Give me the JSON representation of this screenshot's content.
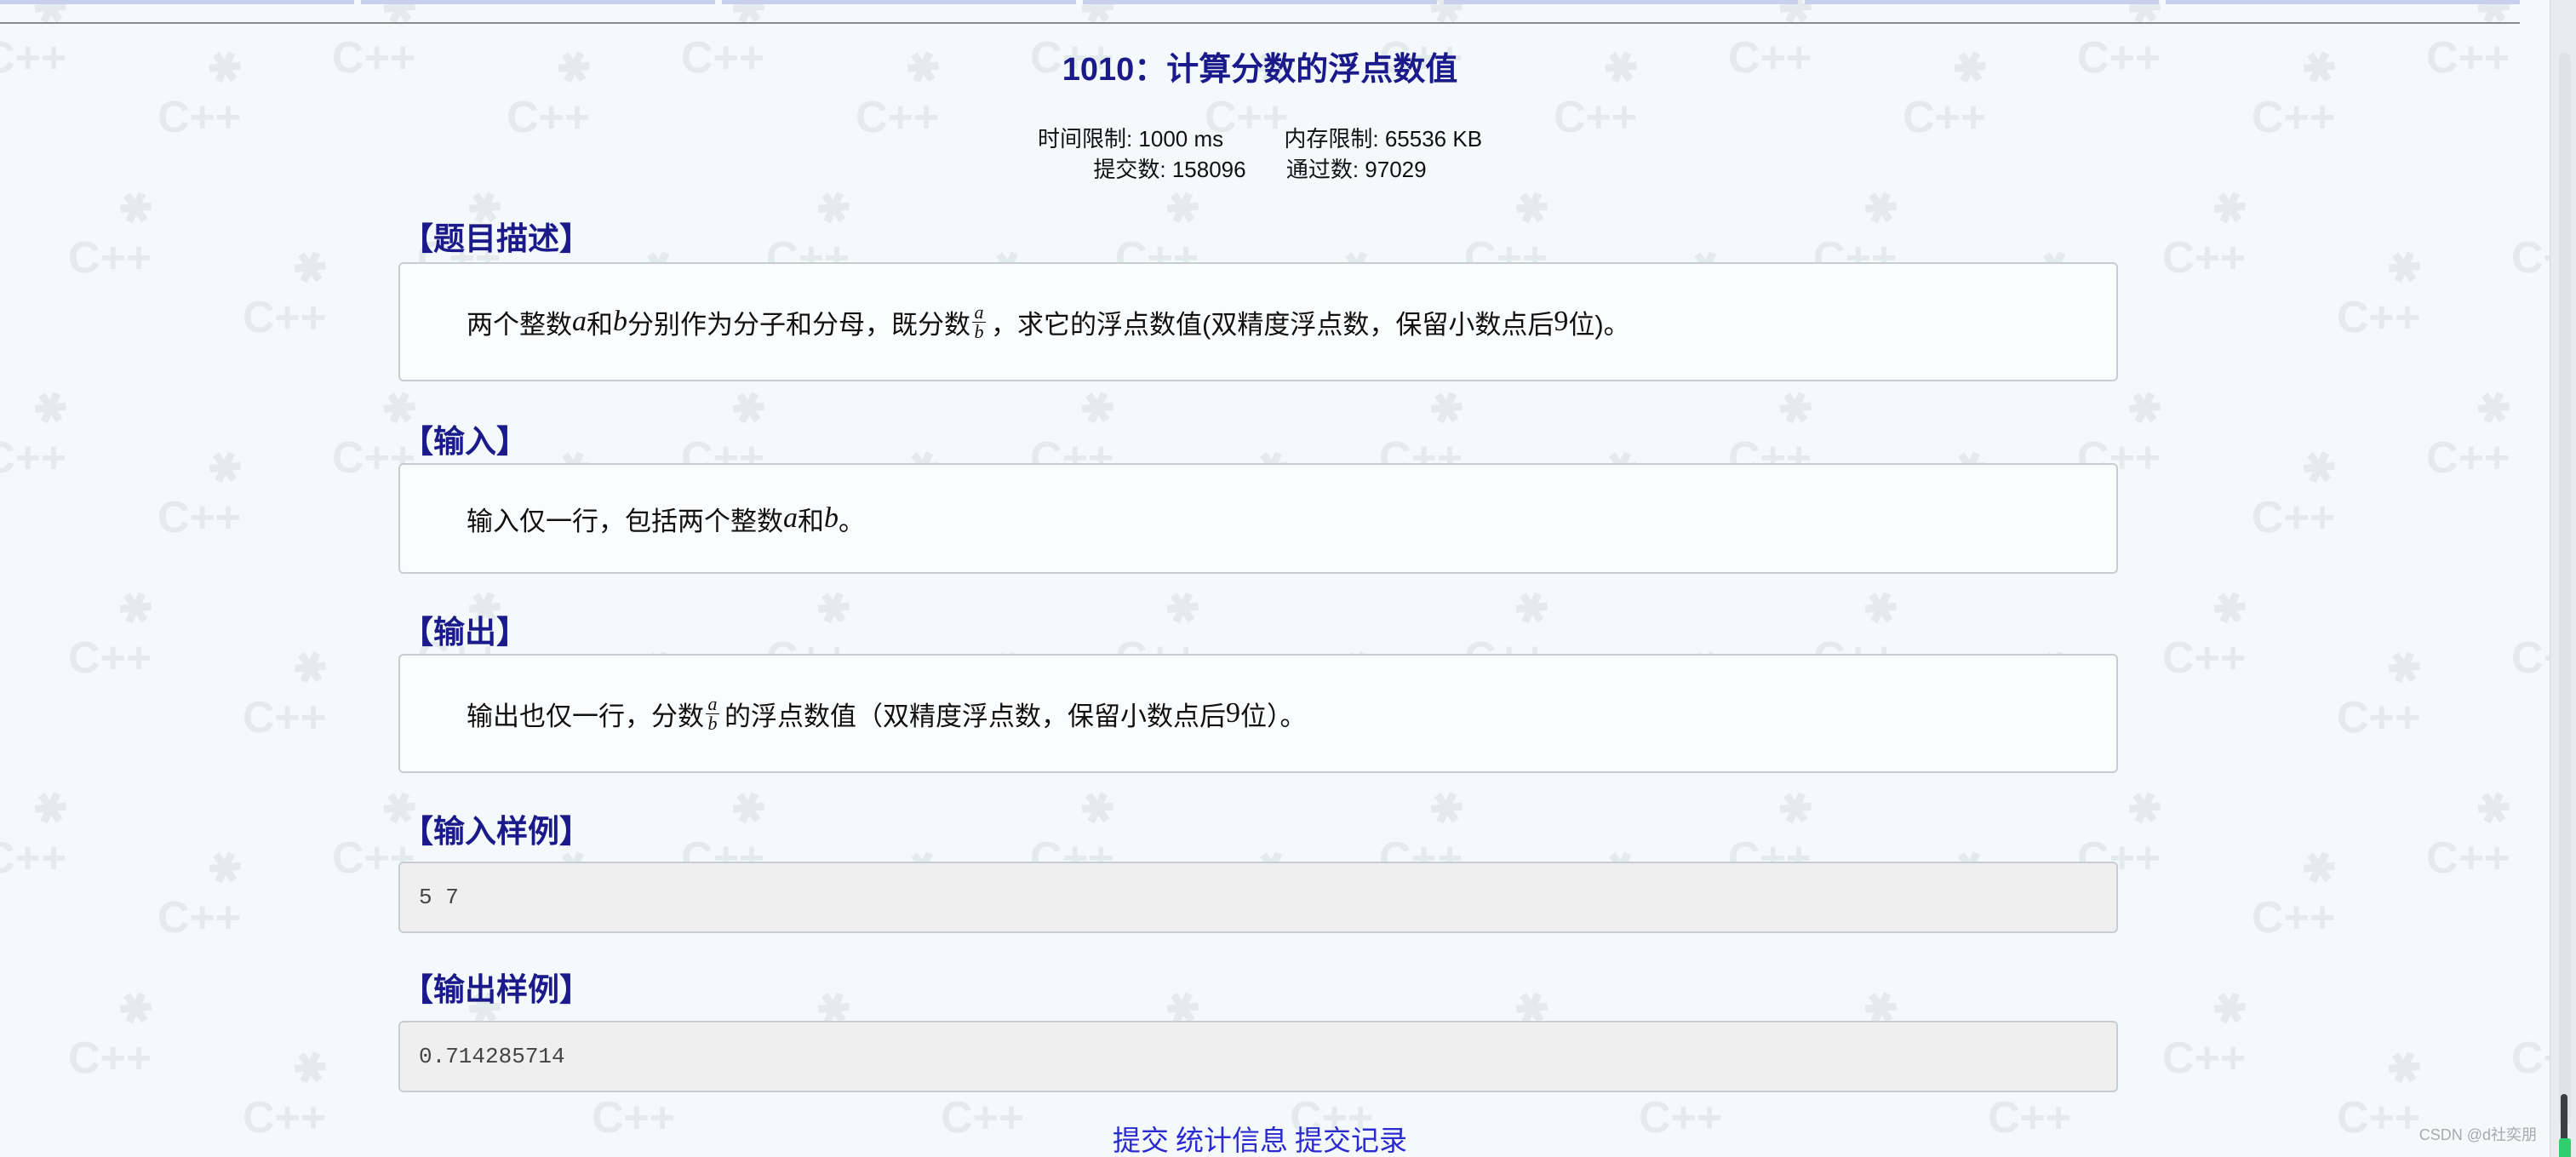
{
  "problem": {
    "title": "1010：计算分数的浮点数值",
    "time_limit": "时间限制: 1000 ms",
    "memory_limit": "内存限制: 65536 KB",
    "submissions": "提交数: 158096",
    "accepted": "通过数: 97029"
  },
  "sections": {
    "description": {
      "heading": "【题目描述】",
      "part1": "两个整数",
      "var_a": "a",
      "part2": "和",
      "var_b": "b",
      "part3": "分别作为分子和分母，既分数",
      "frac_num": "a",
      "frac_den": "b",
      "part4": "，求它的浮点数值(双精度浮点数，保留小数点后",
      "digits": "9",
      "part5": "位)。"
    },
    "input": {
      "heading": "【输入】",
      "part1": "输入仅一行，包括两个整数",
      "var_a": "a",
      "part2": "和",
      "var_b": "b",
      "part3": "。"
    },
    "output": {
      "heading": "【输出】",
      "part1": "输出也仅一行，分数",
      "frac_num": "a",
      "frac_den": "b",
      "part2": " 的浮点数值（双精度浮点数，保留小数点后",
      "digits": "9",
      "part3": "位）。"
    },
    "sample_input": {
      "heading": "【输入样例】",
      "value": "5 7"
    },
    "sample_output": {
      "heading": "【输出样例】",
      "value": "0.714285714"
    }
  },
  "footer_links": {
    "submit": "提交",
    "stats": "统计信息",
    "records": "提交记录"
  },
  "watermark": {
    "text": "C++",
    "csdn": "CSDN @d社奕朋"
  },
  "colors": {
    "heading": "#1a1a8a",
    "link": "#2a2ad0",
    "background": "#f4f9fb"
  }
}
